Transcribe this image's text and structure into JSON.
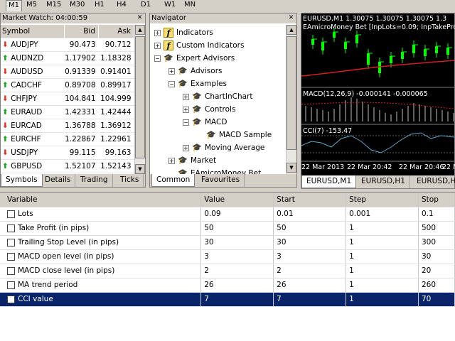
{
  "toolbar": {
    "timeframes": [
      "M1",
      "M5",
      "M15",
      "M30",
      "H1",
      "H4",
      "D1",
      "W1",
      "MN"
    ],
    "selected": "M1"
  },
  "market_watch": {
    "title": "Market Watch: 04:00:59",
    "columns": [
      "Symbol",
      "Bid",
      "Ask"
    ],
    "rows": [
      {
        "symbol": "AUDJPY",
        "bid": "90.473",
        "ask": "90.712",
        "dir": "down"
      },
      {
        "symbol": "AUDNZD",
        "bid": "1.17902",
        "ask": "1.18328",
        "dir": "up"
      },
      {
        "symbol": "AUDUSD",
        "bid": "0.91339",
        "ask": "0.91401",
        "dir": "down"
      },
      {
        "symbol": "CADCHF",
        "bid": "0.89708",
        "ask": "0.89917",
        "dir": "up"
      },
      {
        "symbol": "CHFJPY",
        "bid": "104.841",
        "ask": "104.999",
        "dir": "down"
      },
      {
        "symbol": "EURAUD",
        "bid": "1.42331",
        "ask": "1.42444",
        "dir": "up"
      },
      {
        "symbol": "EURCAD",
        "bid": "1.36788",
        "ask": "1.36912",
        "dir": "down"
      },
      {
        "symbol": "EURCHF",
        "bid": "1.22867",
        "ask": "1.22961",
        "dir": "up"
      },
      {
        "symbol": "USDJPY",
        "bid": "99.115",
        "ask": "99.163",
        "dir": "down"
      },
      {
        "symbol": "GBPUSD",
        "bid": "1.52107",
        "ask": "1.52143",
        "dir": "up"
      }
    ],
    "tabs": [
      "Symbols",
      "Details",
      "Trading",
      "Ticks"
    ]
  },
  "navigator": {
    "title": "Navigator",
    "items": [
      {
        "label": "Indicators",
        "toggle": "+",
        "icon": "f-icon",
        "level": 0
      },
      {
        "label": "Custom Indicators",
        "toggle": "+",
        "icon": "f-icon",
        "level": 0
      },
      {
        "label": "Expert Advisors",
        "toggle": "-",
        "icon": "expert-icon",
        "level": 0
      },
      {
        "label": "Advisors",
        "toggle": "+",
        "icon": "expert-icon",
        "level": 1
      },
      {
        "label": "Examples",
        "toggle": "-",
        "icon": "expert-icon",
        "level": 1
      },
      {
        "label": "ChartInChart",
        "toggle": "+",
        "icon": "expert-icon",
        "level": 2
      },
      {
        "label": "Controls",
        "toggle": "+",
        "icon": "expert-icon",
        "level": 2
      },
      {
        "label": "MACD",
        "toggle": "-",
        "icon": "expert-icon",
        "level": 2
      },
      {
        "label": "MACD Sample",
        "toggle": "",
        "icon": "expert-icon",
        "level": 3
      },
      {
        "label": "Moving Average",
        "toggle": "+",
        "icon": "expert-icon",
        "level": 2
      },
      {
        "label": "Market",
        "toggle": "+",
        "icon": "expert-icon",
        "level": 1
      },
      {
        "label": "EAmicroMoney Bet",
        "toggle": "",
        "icon": "expert-icon",
        "level": 1
      }
    ],
    "tabs": [
      "Common",
      "Favourites"
    ]
  },
  "chart": {
    "header": "EURUSD,M1  1.30075 1.30075 1.30075 1.3",
    "subheader": "EAmicroMoney Bet [InpLots=0.09; InpTakeProfit=",
    "macd_label": "MACD(12,26,9) -0.000141 -0.000065",
    "cci_label": "CCI(7) -153.47",
    "time_labels": [
      "22 Mar 2013",
      "22 Mar 20:42",
      "22 Mar 20:46",
      "22 M"
    ],
    "tabs": [
      "EURUSD,M1",
      "EURUSD,H1",
      "EURUSD,H"
    ]
  },
  "params": {
    "columns": [
      "Variable",
      "Value",
      "Start",
      "Step",
      "Stop"
    ],
    "rows": [
      {
        "name": "Lots",
        "value": "0.09",
        "start": "0.01",
        "step": "0.001",
        "stop": "0.1",
        "highlight": false
      },
      {
        "name": "Take Profit (in pips)",
        "value": "50",
        "start": "50",
        "step": "1",
        "stop": "500",
        "highlight": false
      },
      {
        "name": "Trailing Stop Level (in pips)",
        "value": "30",
        "start": "30",
        "step": "1",
        "stop": "300",
        "highlight": false
      },
      {
        "name": "MACD open level (in pips)",
        "value": "3",
        "start": "3",
        "step": "1",
        "stop": "30",
        "highlight": false
      },
      {
        "name": "MACD close level (in pips)",
        "value": "2",
        "start": "2",
        "step": "1",
        "stop": "20",
        "highlight": false
      },
      {
        "name": "MA trend period",
        "value": "26",
        "start": "26",
        "step": "1",
        "stop": "260",
        "highlight": false
      },
      {
        "name": "CCI value",
        "value": "7",
        "start": "7",
        "step": "1",
        "stop": "70",
        "highlight": true
      }
    ]
  },
  "colors": {
    "up": "#14a514",
    "down": "#e03020",
    "chart_bg": "#000000",
    "candle": "#00ff00",
    "highlight": "#0a246a"
  }
}
